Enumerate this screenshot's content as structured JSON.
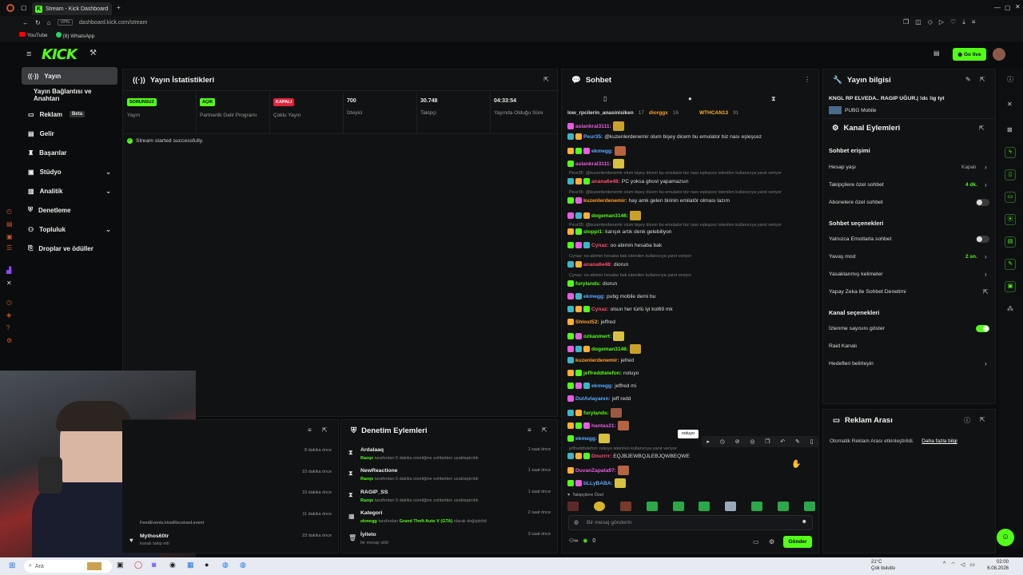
{
  "browser": {
    "tab_title": "Stream - Kick Dashboard",
    "url": "dashboard.kick.com/stream",
    "url_badge": "VPN",
    "bookmarks": [
      "YouTube",
      "(8) WhatsApp"
    ]
  },
  "header": {
    "logo": "KICK",
    "go_live": "Go live"
  },
  "sidebar": {
    "items": [
      {
        "label": "Yayın"
      },
      {
        "label": "Yayın Bağlantısı ve Anahtarı"
      },
      {
        "label": "Reklam",
        "badge": "Beta"
      },
      {
        "label": "Gelir"
      },
      {
        "label": "Başarılar"
      },
      {
        "label": "Stüdyo"
      },
      {
        "label": "Analitik"
      },
      {
        "label": "Denetleme"
      },
      {
        "label": "Topluluk"
      },
      {
        "label": "Droplar ve ödüller"
      }
    ]
  },
  "stats_panel": {
    "title": "Yayın İstatistikleri",
    "items": [
      {
        "badge": "SORUNSUZ",
        "label": "Yayın"
      },
      {
        "badge": "AÇIK",
        "label": "Partnerlik Gelir Programı"
      },
      {
        "badge": "KAPALI",
        "label": "Çoklu Yayın"
      },
      {
        "value": "700",
        "label": "İzleyici"
      },
      {
        "value": "30.748",
        "label": "Takipçi"
      },
      {
        "value": "04:33:54",
        "label": "Yayında Olduğu Süre"
      }
    ],
    "status_msg": "Stream started successfully."
  },
  "activity_panel": {
    "items": [
      {
        "time": "8 dakika önce"
      },
      {
        "time": "10 dakika önce"
      },
      {
        "time": "10 dakika önce"
      },
      {
        "name": "FeedEvents.HostReceived.event",
        "time": "11 dakika önce"
      },
      {
        "name": "Mythos60tr",
        "sub": "kanalı takip etti",
        "time": "23 dakika önce"
      }
    ]
  },
  "mod_panel": {
    "title": "Denetim Eylemleri",
    "items": [
      {
        "name": "Ardalaaq",
        "actor": "Razqx",
        "sub": "tarafından 5 dakika süreliğine sohbetten uzaklaştırıldı",
        "time": "1 saat önce"
      },
      {
        "name": "NewReactione",
        "actor": "Razqx",
        "sub": "tarafından 5 dakika süreliğine sohbetten uzaklaştırıldı",
        "time": "1 saat önce"
      },
      {
        "name": "RAGIP_SS",
        "actor": "Razqx",
        "sub": "tarafından 5 dakika süreliğine sohbetten uzaklaştırıldı",
        "time": "1 saat önce"
      },
      {
        "name": "Kategori",
        "actor": "ekmegg",
        "sub": "tarafından",
        "sub_hl": "Grand Theft Auto V (GTA)",
        "sub2": "olarak değiştirildi",
        "time": "2 saat önce"
      },
      {
        "name": "İyileto",
        "sub": "bir mesajı sildi",
        "time": "3 saat önce"
      }
    ]
  },
  "chat": {
    "title": "Sohbet",
    "top_users": [
      {
        "name": "low_rpcilerin_anasinisiken",
        "n": "17"
      },
      {
        "name": "diorggx",
        "n": "16"
      },
      {
        "name": "WTHCAN13",
        "n": "91"
      }
    ],
    "messages": [
      {
        "user": "aslankral3111:",
        "color": "#e85ce0",
        "text": ""
      },
      {
        "user": "Peur35:",
        "color": "#5aa9ff",
        "text": "@kuzenlerdenemir olum bişey dicem bu emulator biz nası eşleşcez"
      },
      {
        "user": "ekmegg:",
        "color": "#5aa9ff",
        "text": ""
      },
      {
        "user": "aslankral3111:",
        "color": "#e85ce0",
        "text": ""
      },
      {
        "reply": "Peur35: @kuzenlerdenemir olum bişey dicem bu emulator biz nası eşleşcez istenilen kullanıcıya yanıt veriyor"
      },
      {
        "user": "anana6e48:",
        "color": "#ff4d6d",
        "text": "PC yoksa ghost yapamazsın"
      },
      {
        "reply": "Peur35: @kuzenlerdenemir olum bişey dicem bu emulator biz nası eşleşcez istenilen kullanıcıya yanıt veriyor"
      },
      {
        "user": "kuzenlerdenemir:",
        "color": "#ff9f2e",
        "text": "hay amk gelen birinin emilatör olması lazım"
      },
      {
        "user": "dogeman3146:",
        "color": "#53fc18",
        "text": ""
      },
      {
        "reply": "Peur35: @kuzenlerdenemir olum bişey dicem bu emulator biz nası eşleşcez istenilen kullanıcıya yanıt veriyor"
      },
      {
        "user": "sloppi1:",
        "color": "#53fc18",
        "text": "karışık artık denk gelebiliyon"
      },
      {
        "user": "Cynaz:",
        "color": "#ff4d6d",
        "text": "oo abimin hesaba bak"
      },
      {
        "reply": "Cynaz: oo abimin hesaba bak istenilen kullanıcıya yanıt veriyor"
      },
      {
        "user": "anana6e48:",
        "color": "#ff4d6d",
        "text": "diorun"
      },
      {
        "reply": "Cynaz: oo abimin hesaba bak istenilen kullanıcıya yanıt veriyor"
      },
      {
        "user": "furylands:",
        "color": "#53fc18",
        "text": "diorun"
      },
      {
        "user": "ekmegg:",
        "color": "#5aa9ff",
        "text": "pubg mobile demi bu"
      },
      {
        "user": "Cynaz:",
        "color": "#ff4d6d",
        "text": "olsun her türlü iyi kol69 mk"
      },
      {
        "user": "Shlost52:",
        "color": "#ff9f2e",
        "text": "jeffred"
      },
      {
        "user": "ozkanmert:",
        "color": "#53fc18",
        "text": ""
      },
      {
        "user": "dogeman3146:",
        "color": "#53fc18",
        "text": ""
      },
      {
        "user": "kuzenlerdenemir:",
        "color": "#ff9f2e",
        "text": "jefred"
      },
      {
        "user": "jeffreddtelefon:",
        "color": "#53fc18",
        "text": "noluyo"
      },
      {
        "user": "ekmegg:",
        "color": "#5aa9ff",
        "text": "jeffred mi"
      },
      {
        "user": "DulAvlayanın:",
        "color": "#5aa9ff",
        "text": "jeff redd"
      },
      {
        "user": "furylands:",
        "color": "#53fc18",
        "text": ""
      },
      {
        "user": "hantas21:",
        "color": "#e85ce0",
        "text": ""
      },
      {
        "user": "ekmegg:",
        "color": "#5aa9ff",
        "text": ""
      },
      {
        "reply": "jeffreddtelefon: noluyo istenilen kullanıcıya yanıt veriyor"
      },
      {
        "user": "Dnurrrr:",
        "color": "#ff4d6d",
        "text": "EQJBJEWBQJLEBJQWBEQWE"
      },
      {
        "user": "DuvanZapata97:",
        "color": "#e85ce0",
        "text": ""
      },
      {
        "user": "bLLyBABA:",
        "color": "#5aa9ff",
        "text": ""
      }
    ],
    "tooltip": "noluyo",
    "followers_only": "Takipçilere Özel",
    "input_placeholder": "Bir mesaj gönderin",
    "points": "0",
    "send_label": "Gönder"
  },
  "stream_info": {
    "title": "Yayın bilgisi",
    "stream_title": "KNGL RP ELVEDA.. RAGIP UĞUR.| !dc !ig tyt",
    "category": "PUBG Mobile"
  },
  "channel_actions": {
    "title": "Kanal Eylemleri",
    "sec1": "Sohbet erişimi",
    "rows1": [
      {
        "label": "Hesap yaşı",
        "val": "Kapalı"
      },
      {
        "label": "Takipçilere özel sohbet",
        "val": "4 dk."
      },
      {
        "label": "Abonelere özel sohbet"
      }
    ],
    "sec2": "Sohbet seçenekleri",
    "rows2": [
      {
        "label": "Yalnızca Emotlarla sohbet"
      },
      {
        "label": "Yavaş mod",
        "val": "2 sn."
      },
      {
        "label": "Yasaklanmış kelimeler"
      },
      {
        "label": "Yapay Zeka ile Sohbet Denetimi"
      }
    ],
    "sec3": "Kanal seçenekleri",
    "rows3": [
      {
        "label": "İzlenme sayısını göster"
      },
      {
        "label": "Raid Kanalı"
      },
      {
        "label": "Hedefleri belirleyin"
      }
    ]
  },
  "ads": {
    "title": "Reklam Arası",
    "text": "Otomatik Reklam Arası etkinleştirildi.",
    "link": "Daha fazla bilgi"
  },
  "taskbar": {
    "search": "Ara",
    "weather_temp": "21°C",
    "weather_desc": "Çok bulutlu",
    "time": "02:00",
    "date": "6.08.2026"
  },
  "colors": {
    "accent": "#53fc18",
    "panel": "#111213",
    "bg": "#0b0c0d"
  }
}
